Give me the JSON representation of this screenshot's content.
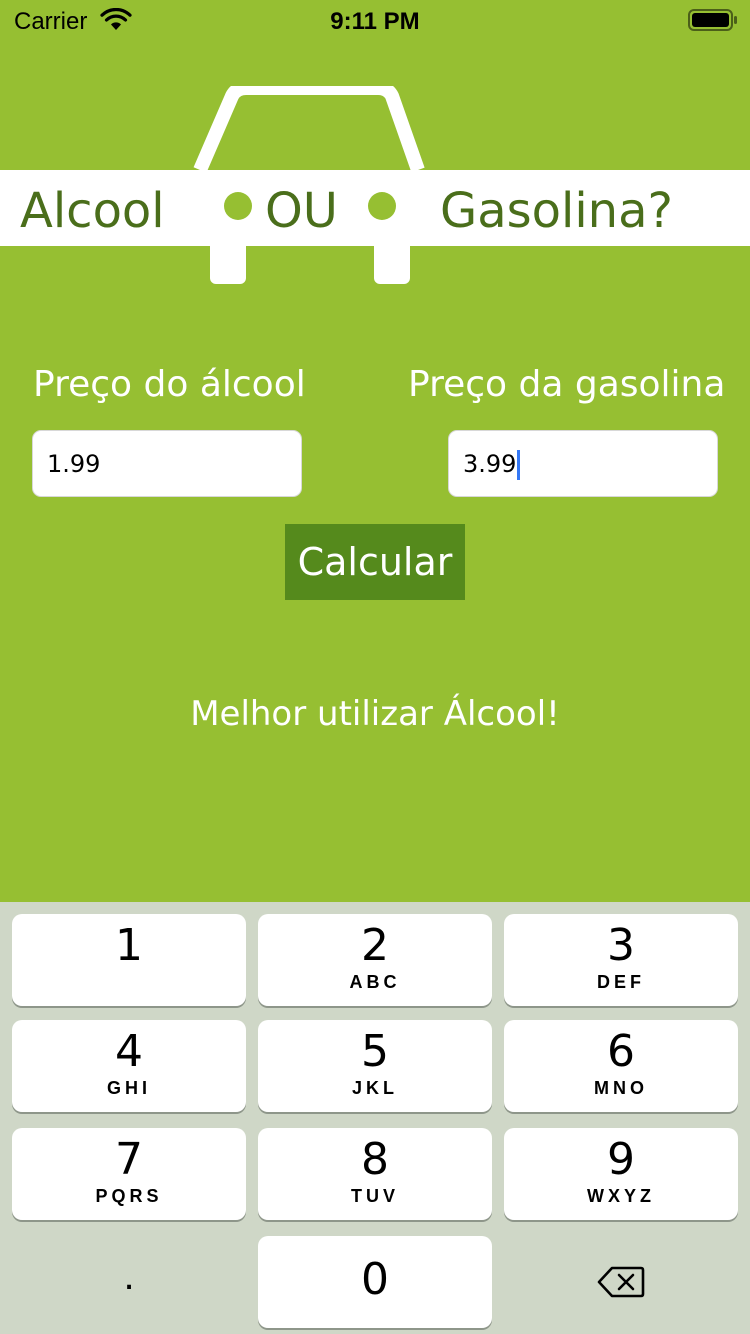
{
  "status_bar": {
    "carrier": "Carrier",
    "time": "9:11 PM"
  },
  "logo": {
    "left_word": "Alcool",
    "middle_word": "OU",
    "right_word": "Gasolina?"
  },
  "form": {
    "alcool_label": "Preço do álcool",
    "alcool_value": "1.99",
    "gasolina_label": "Preço da gasolina",
    "gasolina_value": "3.99",
    "calculate_label": "Calcular"
  },
  "result_text": "Melhor utilizar Álcool!",
  "keyboard": {
    "keys": [
      {
        "num": "1",
        "letters": ""
      },
      {
        "num": "2",
        "letters": "ABC"
      },
      {
        "num": "3",
        "letters": "DEF"
      },
      {
        "num": "4",
        "letters": "GHI"
      },
      {
        "num": "5",
        "letters": "JKL"
      },
      {
        "num": "6",
        "letters": "MNO"
      },
      {
        "num": "7",
        "letters": "PQRS"
      },
      {
        "num": "8",
        "letters": "TUV"
      },
      {
        "num": "9",
        "letters": "WXYZ"
      },
      {
        "num": "0",
        "letters": ""
      }
    ],
    "dot_label": ".",
    "backspace_icon": "backspace-icon"
  },
  "colors": {
    "background": "#96bf32",
    "button": "#558a1c",
    "logo_text": "#4a6e1b",
    "keyboard_bg": "#cfd7c7",
    "cursor": "#3478f6"
  }
}
